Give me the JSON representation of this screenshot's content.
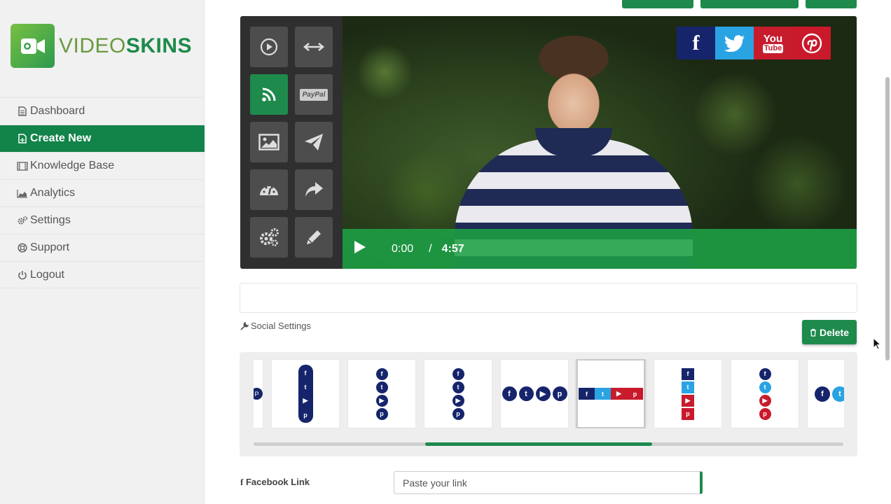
{
  "brand": {
    "name_light": "VIDEO",
    "name_bold": "SKINS"
  },
  "colors": {
    "accent": "#1e8a4c",
    "facebook": "#16256b",
    "twitter": "#2aa3e3",
    "youtube": "#c71c2c",
    "pinterest": "#c9192b"
  },
  "sidebar": {
    "items": [
      {
        "label": "Dashboard",
        "icon": "document-icon"
      },
      {
        "label": "Create New",
        "icon": "new-document-icon",
        "active": true
      },
      {
        "label": "Knowledge Base",
        "icon": "film-icon"
      },
      {
        "label": "Analytics",
        "icon": "area-chart-icon"
      },
      {
        "label": "Settings",
        "icon": "gears-icon"
      },
      {
        "label": "Support",
        "icon": "life-ring-icon"
      },
      {
        "label": "Logout",
        "icon": "power-icon"
      }
    ]
  },
  "player": {
    "current_time": "0:00",
    "separator": "/",
    "duration": "4:57",
    "social": {
      "youtube_line1": "You",
      "youtube_line2": "Tube"
    },
    "tools": [
      "play-icon",
      "resize-icon",
      "rss-icon",
      "paypal-icon",
      "image-icon",
      "send-icon",
      "dashboard-icon",
      "share-icon",
      "gears-icon",
      "pencil-icon"
    ],
    "paypal_text": "PayPal"
  },
  "social_settings": {
    "label": "Social Settings",
    "delete_label": "Delete"
  },
  "facebook_link": {
    "label": "Facebook Link",
    "placeholder": "Paste your link"
  }
}
